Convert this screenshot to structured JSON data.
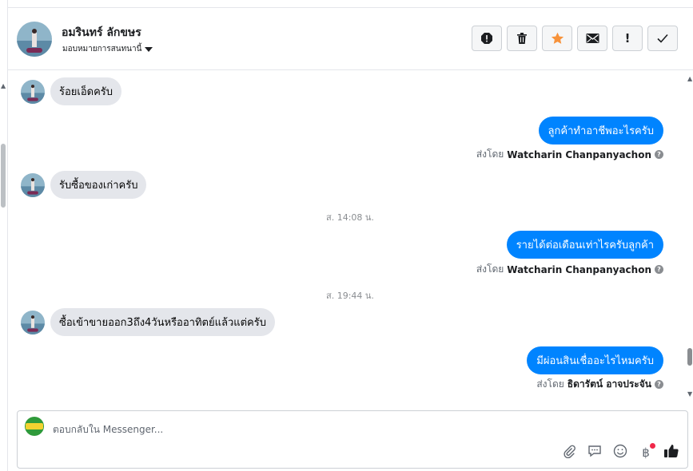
{
  "header": {
    "contact_name": "อมรินทร์ ลักขษร",
    "assign_label": "มอบหมายการสนทนานี้"
  },
  "actions": [
    {
      "name": "report-spam-icon",
      "label": "spam"
    },
    {
      "name": "trash-icon",
      "label": "delete"
    },
    {
      "name": "star-icon",
      "label": "follow up"
    },
    {
      "name": "envelope-icon",
      "label": "mark unread"
    },
    {
      "name": "exclamation-icon",
      "label": "!"
    },
    {
      "name": "check-icon",
      "label": "done"
    }
  ],
  "messages": {
    "m1": "ร้อยเอ็ดครับ",
    "m2": "ลูกค้าทำอาชีพอะไรครับ",
    "m2_sentby_prefix": "ส่งโดย",
    "m2_sender": "Watcharin Chanpanyachon",
    "m3": "รับซื้อของเก่าครับ",
    "ts1": "ส. 14:08 น.",
    "m4": "รายได้ต่อเดือนเท่าไรครับลูกค้า",
    "m4_sentby_prefix": "ส่งโดย",
    "m4_sender": "Watcharin Chanpanyachon",
    "ts2": "ส. 19:44 น.",
    "m5": "ซื้อเข้าขายออก3ถึง4วันหรืออาทิตย์แล้วแต่ครับ",
    "m6": "มีผ่อนสินเชื่ออะไรไหมครับ",
    "m6_sentby_prefix": "ส่งโดย",
    "m6_sender": "ธิดารัตน์ อาจประจัน"
  },
  "composer": {
    "placeholder": "ตอบกลับใน Messenger...",
    "baht_symbol": "฿"
  },
  "colors": {
    "outgoing_bubble": "#0084ff",
    "incoming_bubble": "#e4e6eb",
    "star": "#f7923a"
  }
}
